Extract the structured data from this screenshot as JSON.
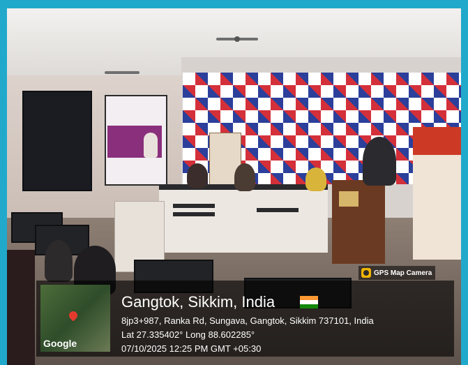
{
  "overlay": {
    "map_logo": "Google",
    "location_title": "Gangtok, Sikkim, India",
    "address": "8jp3+987, Ranka Rd, Sungava, Gangtok, Sikkim 737101, India",
    "coordinates": "Lat 27.335402° Long 88.602285°",
    "datetime": "07/10/2025 12:25 PM GMT +05:30"
  },
  "camera_badge": {
    "label": "GPS Map Camera"
  },
  "colors": {
    "border": "#21a9cc",
    "checker_blue": "#2b3f9b",
    "checker_red": "#d4303a",
    "flag_saffron": "#ff9933",
    "flag_white": "#ffffff",
    "flag_green": "#138808"
  }
}
